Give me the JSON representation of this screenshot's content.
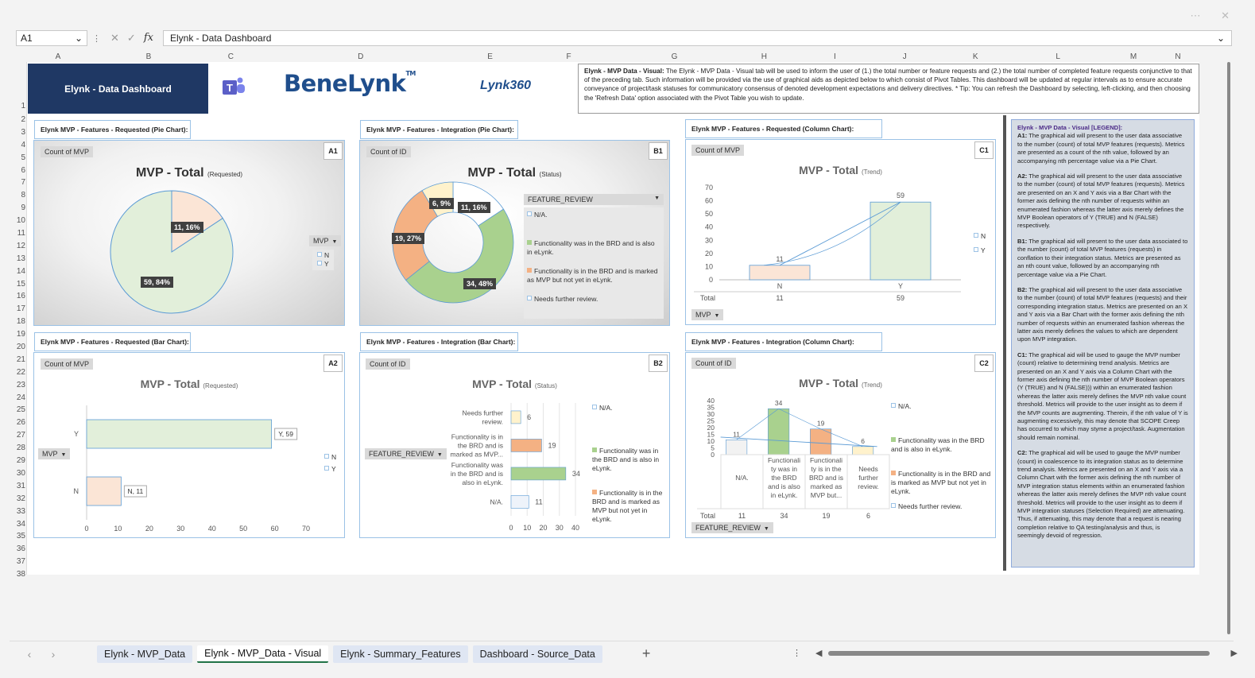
{
  "window": {
    "more_icon": "⋯",
    "close_icon": "✕"
  },
  "formula_bar": {
    "name_box": "A1",
    "formula": "Elynk - Data Dashboard"
  },
  "columns": [
    "A",
    "B",
    "C",
    "D",
    "E",
    "F",
    "G",
    "H",
    "I",
    "J",
    "K",
    "L",
    "M",
    "N"
  ],
  "rows": [
    "1",
    "2",
    "3",
    "4",
    "5",
    "6",
    "7",
    "8",
    "9",
    "10",
    "11",
    "12",
    "13",
    "14",
    "15",
    "16",
    "17",
    "18",
    "19",
    "20",
    "21",
    "22",
    "23",
    "24",
    "25",
    "26",
    "27",
    "28",
    "29",
    "30",
    "31",
    "32",
    "33",
    "34",
    "35",
    "36",
    "37",
    "38"
  ],
  "banner": {
    "title": "Elynk - Data Dashboard",
    "logo_main": "BeneLynk",
    "logo_tm": "TM",
    "logo_secondary": "Lynk360"
  },
  "description": {
    "label": "Elynk - MVP Data - Visual:",
    "text": " The Elynk - MVP Data - Visual tab will be used to inform the user of (1.) the total number or feature requests and (2.) the total number of completed feature requests conjunctive to that of the preceding tab. Such information will be provided via the use of graphical aids as depicted below to which consist of Pivot Tables. This dashboard will be updated at regular intervals as to ensure accurate conveyance of project/task statuses for communicatory consensus of denoted development expectations and delivery directives. * Tip: You can refresh the Dashboard by selecting, left-clicking, and then choosing the 'Refresh Data' option associated with the Pivot Table you wish to update."
  },
  "charts": {
    "a1": {
      "title_box": "Elynk MVP - Features - Requested (Pie Chart):",
      "tag": "A1",
      "field": "Count of MVP",
      "heading": "MVP - Total",
      "sub": "(Requested)",
      "filter": "MVP",
      "legend": [
        "N",
        "Y"
      ],
      "labels": [
        "11, 16%",
        "59, 84%"
      ]
    },
    "b1": {
      "title_box": "Elynk MVP - Features - Integration (Pie Chart):",
      "tag": "B1",
      "field": "Count of ID",
      "heading": "MVP - Total",
      "sub": "(Status)",
      "filter": "FEATURE_REVIEW",
      "legend": [
        "N/A.",
        "Functionality was in the BRD and is also in eLynk.",
        "Functionality is in the BRD and is marked as MVP but not yet in eLynk.",
        "Needs further review."
      ],
      "labels": [
        "6, 9%",
        "11, 16%",
        "19, 27%",
        "34, 48%"
      ]
    },
    "c1": {
      "title_box": "Elynk MVP - Features - Requested (Column Chart):",
      "tag": "C1",
      "field": "Count of MVP",
      "heading": "MVP - Total",
      "sub": "(Trend)",
      "filter": "MVP",
      "legend": [
        "N",
        "Y"
      ],
      "total_label": "Total",
      "totals": [
        "11",
        "59"
      ]
    },
    "a2": {
      "title_box": "Elynk MVP - Features - Requested (Bar Chart):",
      "tag": "A2",
      "field": "Count of MVP",
      "heading": "MVP - Total",
      "sub": "(Requested)",
      "filter": "MVP",
      "legend": [
        "N",
        "Y"
      ],
      "labels": [
        "Y, 59",
        "N, 11"
      ]
    },
    "b2": {
      "title_box": "Elynk MVP - Features - Integration (Bar Chart):",
      "tag": "B2",
      "field": "Count of ID",
      "heading": "MVP - Total",
      "sub": "(Status)",
      "filter": "FEATURE_REVIEW",
      "legend": [
        "N/A.",
        "Functionality was in the BRD and is also in eLynk.",
        "Functionality is in the BRD and is marked as MVP but not yet in eLynk."
      ]
    },
    "c2": {
      "title_box": "Elynk MVP - Features - Integration (Column Chart):",
      "tag": "C2",
      "field": "Count of ID",
      "heading": "MVP - Total",
      "sub": "(Trend)",
      "filter": "FEATURE_REVIEW",
      "legend": [
        "N/A.",
        "Functionality was in the BRD and is also in eLynk.",
        "Functionality is in the BRD and is marked as MVP but not yet in eLynk.",
        "Needs further review."
      ],
      "total_label": "Total",
      "totals": [
        "11",
        "34",
        "19",
        "6"
      ]
    }
  },
  "legend_box": {
    "heading": "Elynk - MVP Data - Visual [LEGEND]:",
    "items": [
      {
        "key": "A1:",
        "text": " The graphical aid will present to the user data associative to the number (count) of total MVP features (requests). Metrics are presented as a count of the nth value, followed by an accompanying nth percentage value via a Pie Chart."
      },
      {
        "key": "A2:",
        "text": " The graphical aid will present to the user data associative to the number (count) of total MVP features (requests). Metrics are presented on an X and Y axis via a Bar Chart with the former axis defining the nth number of requests within an enumerated fashion whereas the latter axis merely defines the MVP Boolean operators of Y (TRUE) and N (FALSE) respectively."
      },
      {
        "key": "B1:",
        "text": " The graphical aid will present to the user data associated to the number (count) of total MVP features (requests) in conflation to their integration status. Metrics are presented as an nth count value, followed by an accompanying nth percentage value via a Pie Chart."
      },
      {
        "key": "B2:",
        "text": " The graphical aid will present to the user data associative to the number (count) of total MVP features (requests) and their corresponding integration status. Metrics are presented on an X and Y axis via a Bar Chart with the former axis defining the nth number of requests within an enumerated fashion whereas the latter axis merely defines the values to which are dependent upon MVP integration."
      },
      {
        "key": "C1:",
        "text": " The graphical aid will be used to gauge the MVP number (count) relative to determining trend analysis. Metrics are presented on an X and Y axis via a Column Chart with the former axis defining the nth number of MVP Boolean operators (Y (TRUE) and N (FALSE))) within an enumerated fashion whereas the latter axis merely defines the MVP nth value count threshold. Metrics will provide to the user insight as to deem if the MVP counts are augmenting. Therein, if the nth value of Y is augmenting excessively, this may denote that SCOPE Creep has occurred to which may styme a project/task. Augmentation should remain nominal."
      },
      {
        "key": "C2:",
        "text": " The graphical aid will be used to gauge the MVP number (count) in coalescence to its integration status as to determine trend analysis. Metrics are presented on an X and Y axis via a Column Chart with the former axis defining the nth number of MVP integration status elements within an enumerated fashion whereas the latter axis merely defines the MVP nth value count threshold. Metrics will provide to the user insight as to deem if MVP integration statuses (Selection Required) are attenuating. Thus, if attenuating, this may denote that a request is nearing completion relative to QA testing/analysis and thus, is seemingly devoid of regression."
      }
    ]
  },
  "tabs": [
    "Elynk - MVP_Data",
    "Elynk - MVP_Data - Visual",
    "Elynk - Summary_Features",
    "Dashboard - Source_Data"
  ],
  "active_tab": 1,
  "colors": {
    "navy": "#1f3864",
    "green": "#a9d18e",
    "greenLight": "#e2efda",
    "orange": "#f4b183",
    "orangeLight": "#fbe5d6",
    "cream": "#fff2cc",
    "accentLine": "#5b9bd5"
  },
  "chart_data": [
    {
      "id": "a1",
      "type": "pie",
      "categories": [
        "N",
        "Y"
      ],
      "values": [
        11,
        59
      ],
      "title": "MVP - Total (Requested)"
    },
    {
      "id": "b1",
      "type": "pie",
      "categories": [
        "N/A.",
        "Functionality was in the BRD and is also in eLynk.",
        "Functionality is in the BRD and is marked as MVP but not yet in eLynk.",
        "Needs further review."
      ],
      "values": [
        11,
        34,
        19,
        6
      ],
      "title": "MVP - Total (Status)"
    },
    {
      "id": "c1",
      "type": "bar",
      "categories": [
        "N",
        "Y"
      ],
      "values": [
        11,
        59
      ],
      "ylim": [
        0,
        70
      ],
      "yticks": [
        0,
        10,
        20,
        30,
        40,
        50,
        60,
        70
      ],
      "title": "MVP - Total (Trend)"
    },
    {
      "id": "a2",
      "type": "bar",
      "orientation": "horizontal",
      "categories": [
        "Y",
        "N"
      ],
      "values": [
        59,
        11
      ],
      "xlim": [
        0,
        70
      ],
      "xticks": [
        0,
        10,
        20,
        30,
        40,
        50,
        60,
        70
      ],
      "title": "MVP - Total (Requested)"
    },
    {
      "id": "b2",
      "type": "bar",
      "orientation": "horizontal",
      "categories": [
        "Needs further review.",
        "Functionality is in the BRD and is marked as MVP...",
        "Functionality was in the BRD and is also in eLynk.",
        "N/A."
      ],
      "values": [
        6,
        19,
        34,
        11
      ],
      "xlim": [
        0,
        40
      ],
      "xticks": [
        0,
        10,
        20,
        30,
        40
      ],
      "title": "MVP - Total (Status)"
    },
    {
      "id": "c2",
      "type": "bar",
      "categories": [
        "N/A.",
        "Functionality was in the BRD and is also in eLynk.",
        "Functionality is in the BRD and is marked as MVP but...",
        "Needs further review."
      ],
      "values": [
        11,
        34,
        19,
        6
      ],
      "ylim": [
        0,
        40
      ],
      "yticks": [
        0,
        5,
        10,
        15,
        20,
        25,
        30,
        35,
        40
      ],
      "title": "MVP - Total (Trend)"
    }
  ]
}
